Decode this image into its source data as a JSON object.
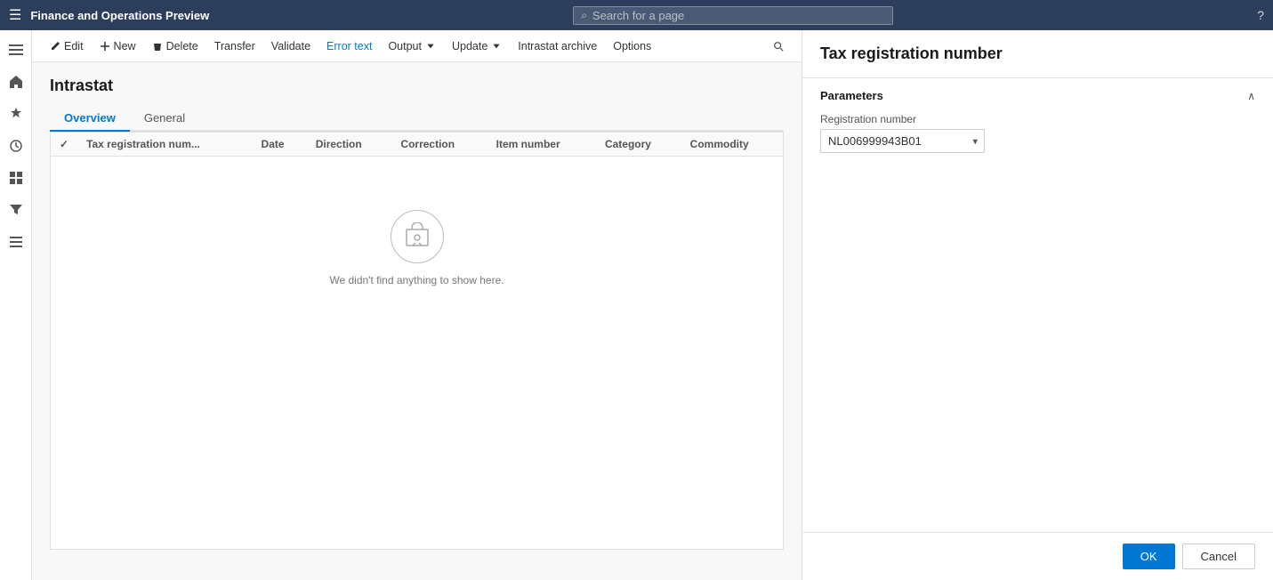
{
  "app": {
    "title": "Finance and Operations Preview",
    "search_placeholder": "Search for a page"
  },
  "sidebar": {
    "icons": [
      {
        "name": "hamburger-icon",
        "symbol": "☰"
      },
      {
        "name": "home-icon",
        "symbol": "⌂"
      },
      {
        "name": "favorites-icon",
        "symbol": "★"
      },
      {
        "name": "recent-icon",
        "symbol": "🕐"
      },
      {
        "name": "workspaces-icon",
        "symbol": "⊞"
      },
      {
        "name": "list-icon",
        "symbol": "≡"
      }
    ]
  },
  "action_bar": {
    "edit": "Edit",
    "new": "New",
    "delete": "Delete",
    "transfer": "Transfer",
    "validate": "Validate",
    "error_text": "Error text",
    "output": "Output",
    "update": "Update",
    "intrastat_archive": "Intrastat archive",
    "options": "Options"
  },
  "page": {
    "title": "Intrastat",
    "tabs": [
      {
        "label": "Overview",
        "active": true
      },
      {
        "label": "General",
        "active": false
      }
    ],
    "table": {
      "columns": [
        {
          "key": "check",
          "label": "✓"
        },
        {
          "key": "tax_reg",
          "label": "Tax registration num..."
        },
        {
          "key": "date",
          "label": "Date"
        },
        {
          "key": "direction",
          "label": "Direction"
        },
        {
          "key": "correction",
          "label": "Correction"
        },
        {
          "key": "item_number",
          "label": "Item number"
        },
        {
          "key": "category",
          "label": "Category"
        },
        {
          "key": "commodity",
          "label": "Commodity"
        }
      ],
      "empty_message": "We didn't find anything to show here."
    }
  },
  "right_panel": {
    "title": "Tax registration number",
    "section_title": "Parameters",
    "registration_number_label": "Registration number",
    "registration_number_value": "NL006999943B01",
    "registration_number_options": [
      "NL006999943B01"
    ],
    "ok_label": "OK",
    "cancel_label": "Cancel"
  },
  "help": "?"
}
